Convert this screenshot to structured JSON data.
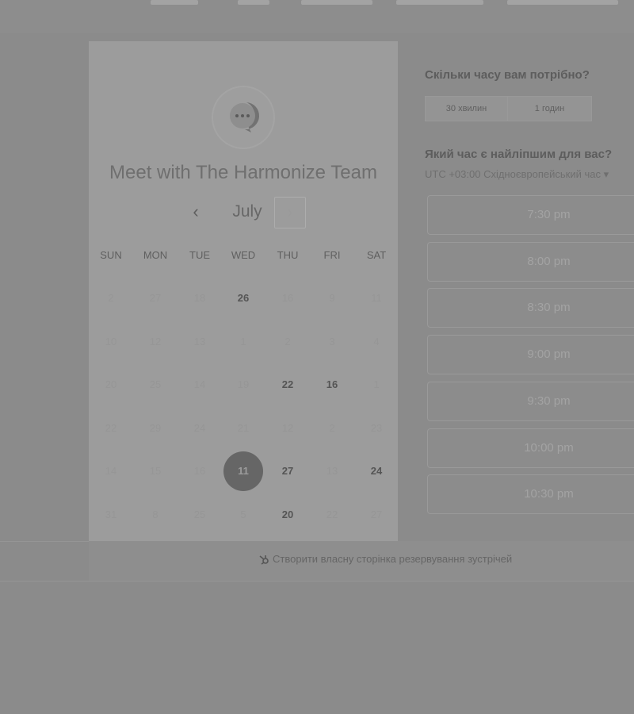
{
  "calendar": {
    "title": "Meet with The Harmonize Team",
    "month": "July",
    "prev_symbol": "‹",
    "next_symbol": "›",
    "weekdays": [
      "SUN",
      "MON",
      "TUE",
      "WED",
      "THU",
      "FRI",
      "SAT"
    ],
    "weeks": [
      [
        {
          "d": "2",
          "s": "n"
        },
        {
          "d": "27",
          "s": "n"
        },
        {
          "d": "18",
          "s": "n"
        },
        {
          "d": "26",
          "s": "a"
        },
        {
          "d": "16",
          "s": "n"
        },
        {
          "d": "9",
          "s": "n"
        },
        {
          "d": "11",
          "s": "n"
        }
      ],
      [
        {
          "d": "10",
          "s": "n"
        },
        {
          "d": "12",
          "s": "n"
        },
        {
          "d": "13",
          "s": "n"
        },
        {
          "d": "1",
          "s": "n"
        },
        {
          "d": "2",
          "s": "n"
        },
        {
          "d": "3",
          "s": "n"
        },
        {
          "d": "4",
          "s": "n"
        }
      ],
      [
        {
          "d": "20",
          "s": "n"
        },
        {
          "d": "25",
          "s": "n"
        },
        {
          "d": "14",
          "s": "n"
        },
        {
          "d": "19",
          "s": "n"
        },
        {
          "d": "22",
          "s": "a"
        },
        {
          "d": "16",
          "s": "a"
        },
        {
          "d": "1",
          "s": "n"
        }
      ],
      [
        {
          "d": "22",
          "s": "n"
        },
        {
          "d": "29",
          "s": "n"
        },
        {
          "d": "24",
          "s": "n"
        },
        {
          "d": "21",
          "s": "n"
        },
        {
          "d": "12",
          "s": "n"
        },
        {
          "d": "2",
          "s": "n"
        },
        {
          "d": "23",
          "s": "n"
        }
      ],
      [
        {
          "d": "14",
          "s": "n"
        },
        {
          "d": "15",
          "s": "n"
        },
        {
          "d": "16",
          "s": "n"
        },
        {
          "d": "11",
          "s": "sel"
        },
        {
          "d": "27",
          "s": "a"
        },
        {
          "d": "13",
          "s": "n"
        },
        {
          "d": "24",
          "s": "a"
        }
      ],
      [
        {
          "d": "31",
          "s": "n"
        },
        {
          "d": "8",
          "s": "n"
        },
        {
          "d": "25",
          "s": "n"
        },
        {
          "d": "5",
          "s": "n"
        },
        {
          "d": "20",
          "s": "a"
        },
        {
          "d": "22",
          "s": "n"
        },
        {
          "d": "27",
          "s": "n"
        }
      ]
    ]
  },
  "duration": {
    "question": "Скільки часу вам потрібно?",
    "options": [
      "30 хвилин",
      "1 годин"
    ]
  },
  "time": {
    "question": "Який час є найліпшим для вас?",
    "timezone": "UTC +03:00 Східноєвропейський час ▾",
    "slots": [
      "7:30 pm",
      "8:00 pm",
      "8:30 pm",
      "9:00 pm",
      "9:30 pm",
      "10:00 pm",
      "10:30 pm"
    ]
  },
  "footer": {
    "link_text": "Створити власну сторінка резервування зустрічей"
  }
}
